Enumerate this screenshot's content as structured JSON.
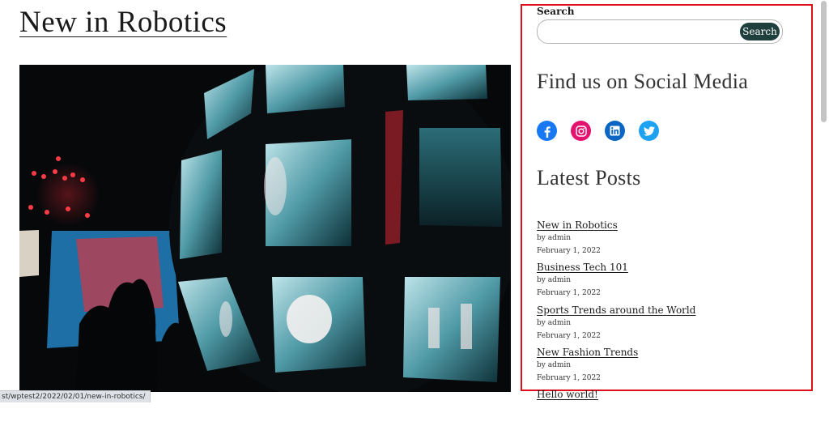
{
  "post": {
    "title": "New in Robotics"
  },
  "status_bar": {
    "url": "st/wptest2/2022/02/01/new-in-robotics/"
  },
  "sidebar": {
    "search": {
      "label": "Search",
      "placeholder": "",
      "value": "",
      "button_label": "Search"
    },
    "social": {
      "heading": "Find us on Social Media",
      "links": [
        {
          "icon": "facebook-icon",
          "color": "#1877f2"
        },
        {
          "icon": "instagram-icon",
          "color": "#e4126f"
        },
        {
          "icon": "linkedin-icon",
          "color": "#0a66c2"
        },
        {
          "icon": "twitter-icon",
          "color": "#1da1f2"
        }
      ]
    },
    "latest_posts": {
      "heading": "Latest Posts",
      "items": [
        {
          "title": "New in Robotics",
          "author": "by admin",
          "date": "February 1, 2022"
        },
        {
          "title": "Business Tech 101",
          "author": "by admin",
          "date": "February 1, 2022"
        },
        {
          "title": "Sports Trends around the World",
          "author": "by admin",
          "date": "February 1, 2022"
        },
        {
          "title": "New Fashion Trends",
          "author": "by admin",
          "date": "February 1, 2022"
        },
        {
          "title": "Hello world!"
        }
      ]
    }
  },
  "colors": {
    "highlight_border": "#e0101b",
    "search_button_bg": "#1e3f3c"
  }
}
